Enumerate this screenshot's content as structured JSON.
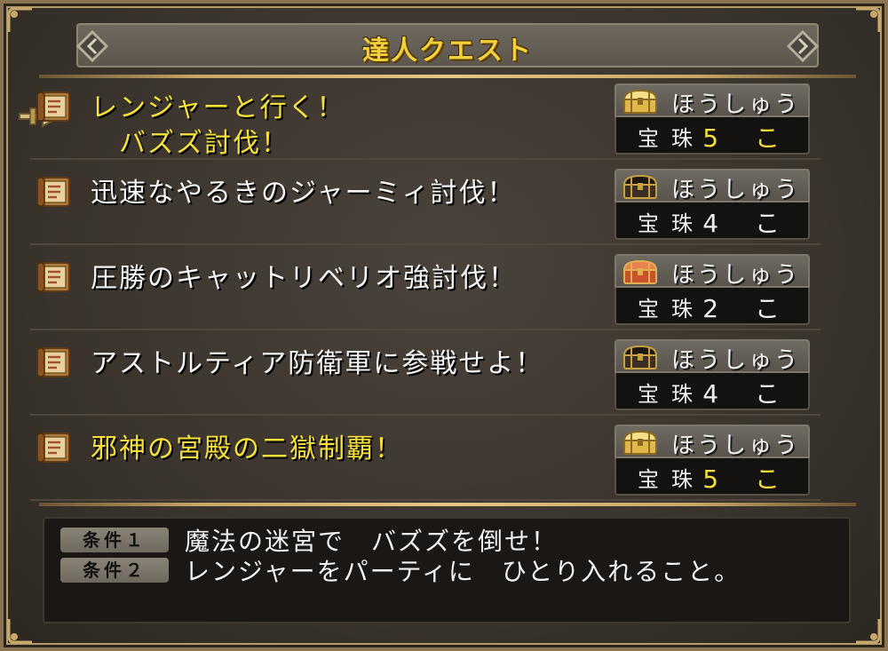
{
  "window": {
    "title": "達人クエスト"
  },
  "quests": [
    {
      "name": "レンジャーと行く！\n　バズズ討伐！",
      "highlight": true,
      "selected": true,
      "reward_label": "ほうしゅう",
      "reward_item": "宝珠",
      "reward_count": "5 こ",
      "chest_icon": "gold-chest-icon"
    },
    {
      "name": "迅速なやるきのジャーミィ討伐！",
      "highlight": false,
      "selected": false,
      "reward_label": "ほうしゅう",
      "reward_item": "宝珠",
      "reward_count": "4 こ",
      "chest_icon": "dark-chest-icon"
    },
    {
      "name": "圧勝のキャットリベリオ強討伐！",
      "highlight": false,
      "selected": false,
      "reward_label": "ほうしゅう",
      "reward_item": "宝珠",
      "reward_count": "2 こ",
      "chest_icon": "red-chest-icon"
    },
    {
      "name": "アストルティア防衛軍に参戦せよ！",
      "highlight": false,
      "selected": false,
      "reward_label": "ほうしゅう",
      "reward_item": "宝珠",
      "reward_count": "4 こ",
      "chest_icon": "dark-chest-icon"
    },
    {
      "name": "邪神の宮殿の二獄制覇！",
      "highlight": true,
      "selected": false,
      "reward_label": "ほうしゅう",
      "reward_item": "宝珠",
      "reward_count": "5 こ",
      "chest_icon": "gold-chest-icon"
    }
  ],
  "conditions": [
    {
      "label": "条件１",
      "text": "魔法の迷宮で　バズズを倒せ！"
    },
    {
      "label": "条件２",
      "text": "レンジャーをパーティに　ひとり入れること。"
    }
  ],
  "colors": {
    "highlight_text": "#f5e03a",
    "title_text": "#f2cf3b",
    "frame": "#8c7450"
  }
}
